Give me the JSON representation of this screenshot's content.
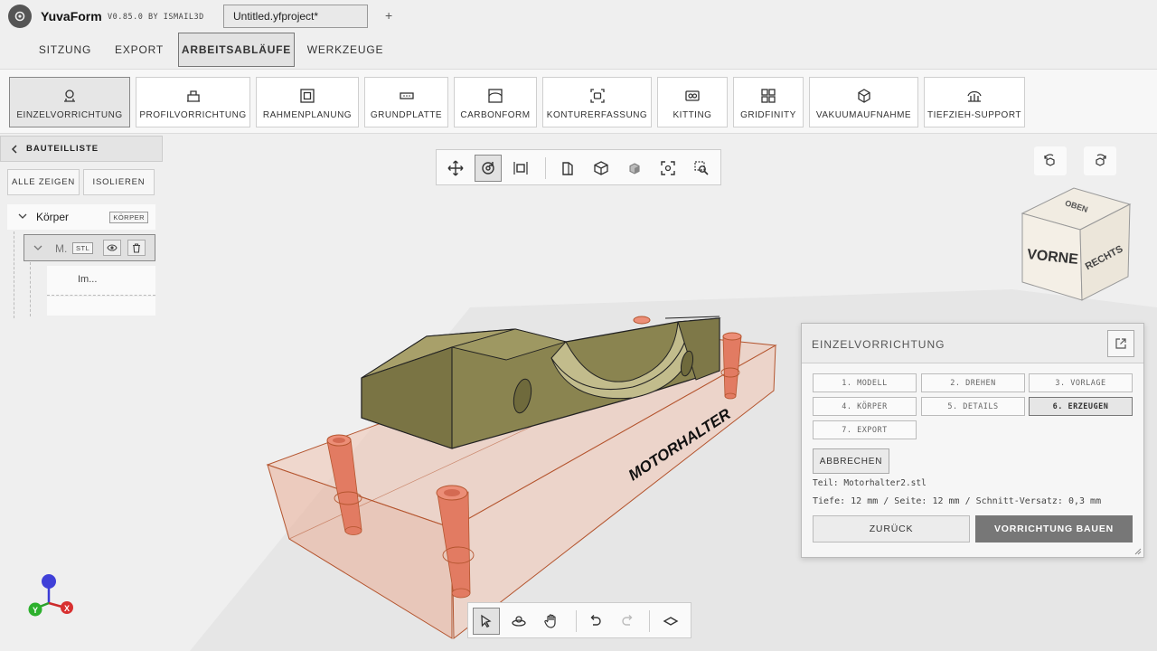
{
  "app": {
    "name": "YuvaForm",
    "version": "V0.85.0 BY ISMAIL3D",
    "file_tab": "Untitled.yfproject*",
    "new_tab": "+"
  },
  "menu": {
    "tabs": [
      {
        "label": "SITZUNG"
      },
      {
        "label": "EXPORT"
      },
      {
        "label": "ARBEITSABLÄUFE",
        "active": true
      },
      {
        "label": "WERKZEUGE"
      }
    ]
  },
  "ribbon": {
    "items": [
      {
        "label": "EINZELVORRICHTUNG",
        "icon": "single-fixture-icon",
        "active": true
      },
      {
        "label": "PROFILVORRICHTUNG",
        "icon": "profile-fixture-icon"
      },
      {
        "label": "RAHMENPLANUNG",
        "icon": "frame-icon"
      },
      {
        "label": "GRUNDPLATTE",
        "icon": "baseplate-icon"
      },
      {
        "label": "CARBONFORM",
        "icon": "carbon-form-icon"
      },
      {
        "label": "KONTURERFASSUNG",
        "icon": "contour-icon"
      },
      {
        "label": "KITTING",
        "icon": "kitting-icon"
      },
      {
        "label": "GRIDFINITY",
        "icon": "grid-icon"
      },
      {
        "label": "VAKUUMAUFNAHME",
        "icon": "vacuum-icon"
      },
      {
        "label": "TIEFZIEH-SUPPORT",
        "icon": "thermoform-icon"
      }
    ]
  },
  "sidebar": {
    "title": "BAUTEILLISTE",
    "show_all": "ALLE ZEIGEN",
    "isolate": "ISOLIEREN",
    "root": {
      "name": "Körper",
      "tag": "KÖRPER"
    },
    "child": {
      "name": "M.",
      "tag": "STL"
    },
    "grandchild": {
      "name": "Im..."
    }
  },
  "viewcube": {
    "front": "VORNE",
    "top": "OBEN",
    "right": "RECHTS"
  },
  "axis": {
    "x": "X",
    "y": "Y"
  },
  "model": {
    "label": "MOTORHALTER"
  },
  "panel": {
    "title": "EINZELVORRICHTUNG",
    "steps": [
      {
        "label": "1. MODELL"
      },
      {
        "label": "2. DREHEN"
      },
      {
        "label": "3. VORLAGE"
      },
      {
        "label": "4. KÖRPER"
      },
      {
        "label": "5. DETAILS"
      },
      {
        "label": "6. ERZEUGEN",
        "active": true
      },
      {
        "label": "7. EXPORT"
      }
    ],
    "cancel": "ABBRECHEN",
    "part": "Teil: Motorhalter2.stl",
    "params": "Tiefe: 12 mm / Seite: 12 mm / Schnitt-Versatz: 0,3 mm",
    "back": "ZURÜCK",
    "build": "VORRICHTUNG BAUEN"
  },
  "colors": {
    "part": "#8a8450",
    "fixture": "#e8b8a4",
    "pin": "#e07a60",
    "accent": "#777777"
  }
}
